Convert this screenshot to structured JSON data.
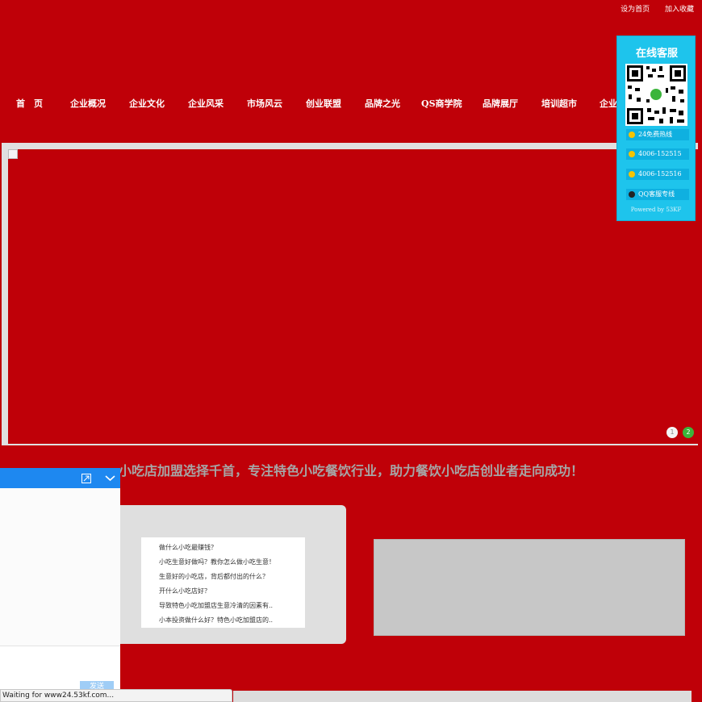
{
  "top_links": {
    "set_homepage": "设为首页",
    "add_favorite": "加入收藏"
  },
  "nav": [
    "首　页",
    "企业概况",
    "企业文化",
    "企业风采",
    "市场风云",
    "创业联盟",
    "品牌之光",
    "QS商学院",
    "品牌展厅",
    "培训超市",
    "企业"
  ],
  "banner": {
    "dots": [
      "1",
      "2"
    ],
    "active_dot": 2
  },
  "slogan": "小吃店加盟选择千首，专注特色小吃餐饮行业，助力餐饮小吃店创业者走向成功！",
  "news": [
    "做什么小吃最赚钱？",
    "小吃生意好做吗？教你怎么做小吃生意！",
    "生意好的小吃店，背后都付出的什么？",
    "开什么小吃店好？",
    "导致特色小吃加盟店生意冷清的因素有..",
    "小本投资做什么好？特色小吃加盟店的.."
  ],
  "service_widget": {
    "title": "在线客服",
    "items": [
      "24免费热线",
      "4006-152515",
      "4006-152516",
      "QQ客服专线"
    ],
    "powered": "Powered by 53KF"
  },
  "chat": {
    "send_label": "发送"
  },
  "status_bar": "Waiting for www24.53kf.com...",
  "colors": {
    "brand_red": "#bf0008",
    "service_blue": "#1ec4ec",
    "chat_blue": "#1e88f0"
  }
}
